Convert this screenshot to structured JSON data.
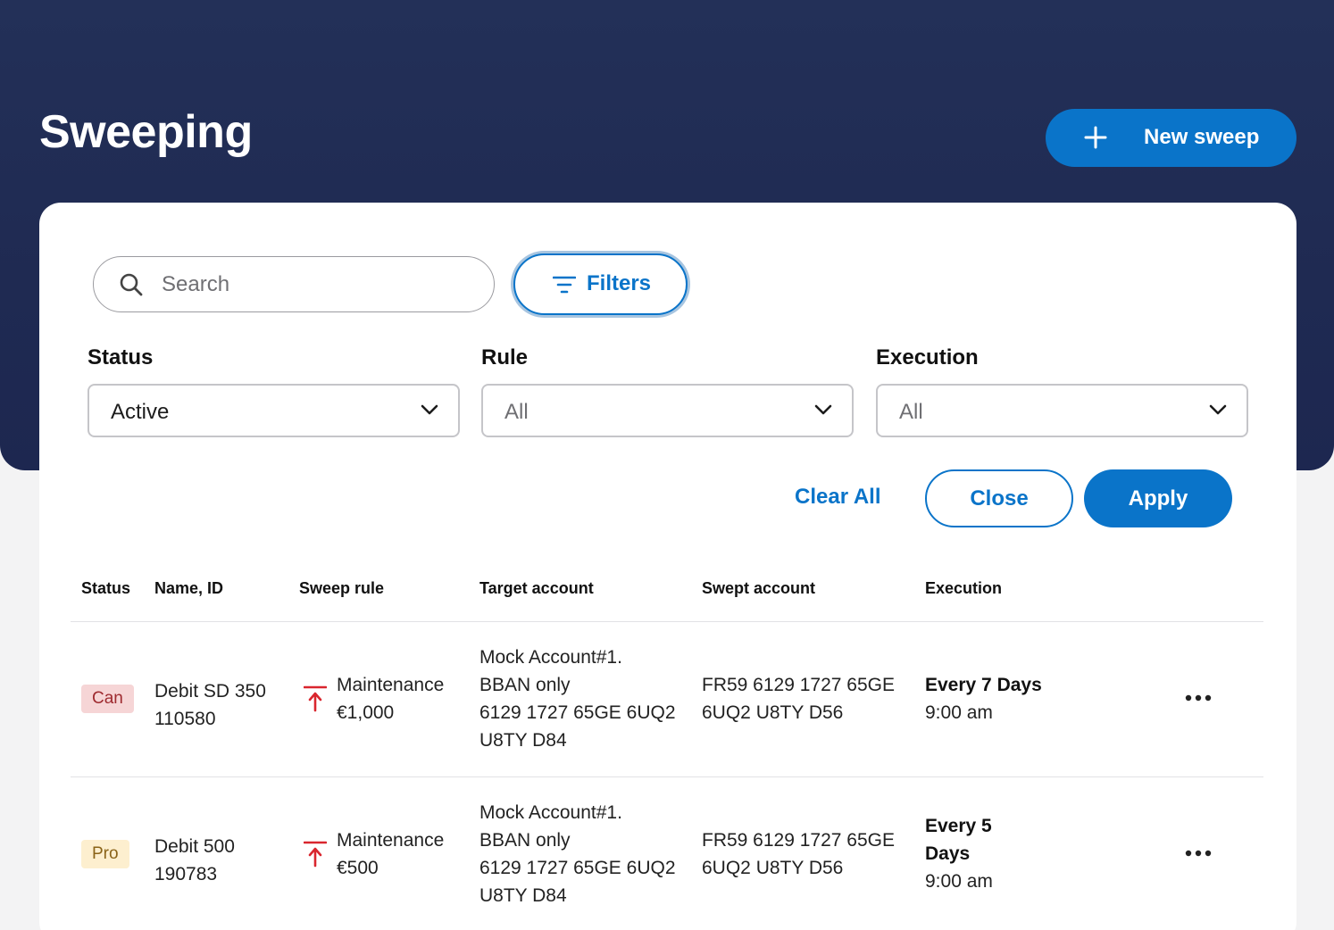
{
  "page": {
    "title": "Sweeping"
  },
  "header": {
    "new_sweep_label": "New sweep"
  },
  "search": {
    "placeholder": "Search"
  },
  "filters": {
    "button_label": "Filters",
    "status": {
      "label": "Status",
      "value": "Active"
    },
    "rule": {
      "label": "Rule",
      "value": "All"
    },
    "execution": {
      "label": "Execution",
      "value": "All"
    },
    "clear_all_label": "Clear All",
    "close_label": "Close",
    "apply_label": "Apply"
  },
  "table": {
    "headers": [
      "Status",
      "Name, ID",
      "Sweep rule",
      "Target account",
      "Swept account",
      "Execution"
    ],
    "rows": [
      {
        "status": "Can",
        "name": "Debit SD 350",
        "id": "110580",
        "rule_name": "Maintenance",
        "rule_amount": "€1,000",
        "target_lines": [
          "Mock Account#1.",
          "BBAN only",
          "6129 1727 65GE 6UQ2",
          "U8TY D84"
        ],
        "swept_lines": [
          "FR59 6129 1727 65GE",
          "6UQ2 U8TY D56"
        ],
        "exec_freq_lines": [
          "Every 7 Days"
        ],
        "exec_time": "9:00 am"
      },
      {
        "status": "Pro",
        "name": "Debit 500",
        "id": "190783",
        "rule_name": "Maintenance",
        "rule_amount": "€500",
        "target_lines": [
          "Mock Account#1.",
          "BBAN only",
          "6129 1727 65GE 6UQ2",
          "U8TY D84"
        ],
        "swept_lines": [
          "FR59 6129 1727 65GE",
          "6UQ2 U8TY D56"
        ],
        "exec_freq_lines": [
          "Every 5",
          "Days"
        ],
        "exec_time": "9:00 am"
      }
    ]
  },
  "colors": {
    "header_bg": "#233058",
    "primary": "#0a74c9",
    "status_can_bg": "#f6d5d6",
    "status_pro_bg": "#fdefcf",
    "rule_icon": "#d9262e"
  },
  "icons": {
    "new_sweep": "plus-icon",
    "search": "search-icon",
    "filters": "filter-icon",
    "select": "chevron-down-icon",
    "rule": "arrow-up-to-line-icon",
    "row_actions": "more-horizontal-icon"
  }
}
